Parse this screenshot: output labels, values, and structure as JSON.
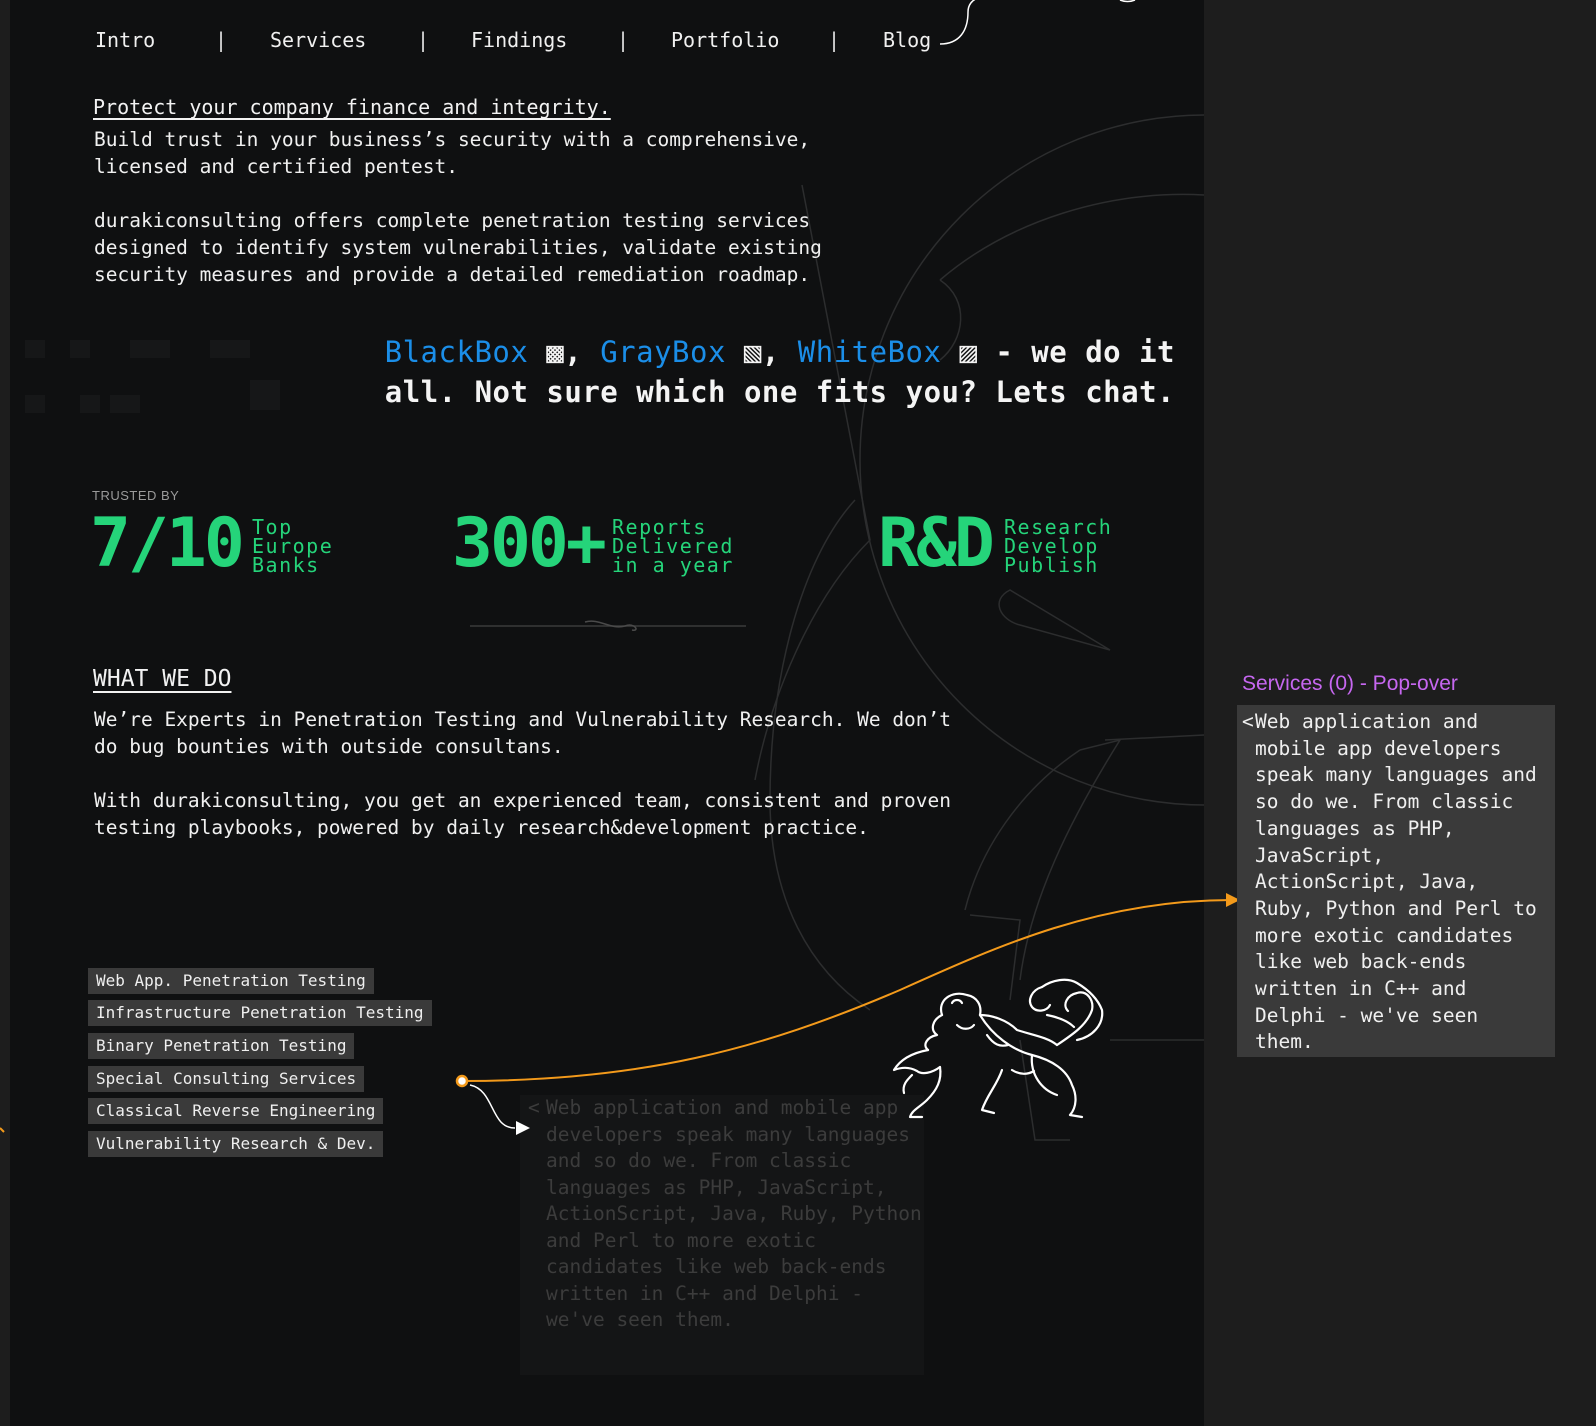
{
  "nav": {
    "items": [
      {
        "label": "Intro"
      },
      {
        "label": "Services"
      },
      {
        "label": "Findings"
      },
      {
        "label": "Portfolio"
      },
      {
        "label": "Blog"
      }
    ],
    "separator": "|"
  },
  "hero": {
    "heading": "Protect your company finance and integrity.",
    "intro": "Build trust in your business’s security with a comprehensive, licensed and certified pentest.",
    "description": "durakiconsulting offers complete penetration testing services designed to identify system vulnerabilities, validate existing security measures and provide a detailed remediation roadmap."
  },
  "tagline": {
    "blackbox": "BlackBox",
    "graybox": "GrayBox",
    "whitebox": "WhiteBox",
    "comma": ",",
    "rest": "- we do it all. Not sure which one fits you? Lets chat."
  },
  "trusted": {
    "label": "TRUSTED BY",
    "stats": [
      {
        "value": "7/10",
        "desc": [
          "Top",
          "Europe",
          "Banks"
        ]
      },
      {
        "value": "300+",
        "desc": [
          "Reports",
          "Delivered",
          "in a year"
        ]
      },
      {
        "value": "R&D",
        "desc": [
          "Research",
          "Develop",
          "Publish"
        ]
      }
    ]
  },
  "what_we_do": {
    "title": "WHAT WE DO",
    "p1": "We’re Experts in Penetration Testing and Vulnerability Research. We don’t do bug bounties with outside consultans.",
    "p2": "With durakiconsulting, you get an experienced team, consistent and proven testing playbooks, powered by daily research&development practice."
  },
  "services": [
    {
      "label": "Web App. Penetration Testing"
    },
    {
      "label": "Infrastructure Penetration Testing"
    },
    {
      "label": "Binary Penetration Testing"
    },
    {
      "label": "Special Consulting Services"
    },
    {
      "label": "Classical Reverse Engineering"
    },
    {
      "label": "Vulnerability Research & Dev."
    }
  ],
  "popover": {
    "label": "Services (0) - Pop-over",
    "chevron": "<",
    "text": "Web application and mobile app developers speak many languages and so do we. From classic languages as PHP, JavaScript, ActionScript, Java, Ruby, Python and Perl to more exotic candidates like web back-ends written in C++ and Delphi - we've seen them."
  },
  "colors": {
    "accent_green": "#25d47a",
    "accent_blue": "#1b8ee8",
    "annotation_orange": "#f39a1b",
    "annotation_purple": "#c667f0"
  }
}
